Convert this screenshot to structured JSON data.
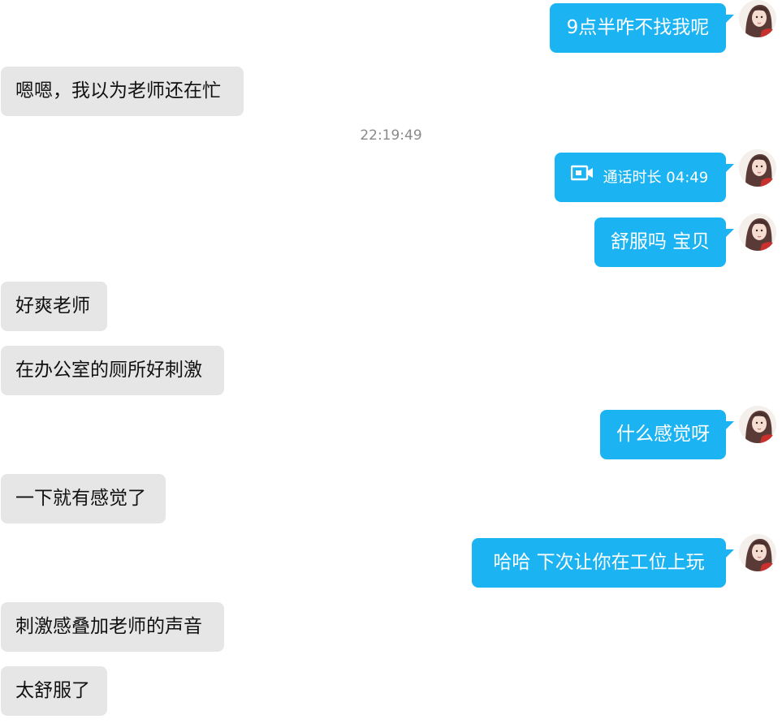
{
  "timestamp": "22:19:49",
  "messages": [
    {
      "side": "out",
      "text": "9点半咋不找我呢"
    },
    {
      "side": "in",
      "text": "嗯嗯，我以为老师还在忙"
    },
    {
      "side": "out",
      "type": "call",
      "icon": "video-camera-icon",
      "text": "通话时长 04:49"
    },
    {
      "side": "out",
      "text": "舒服吗 宝贝"
    },
    {
      "side": "in",
      "text": "好爽老师"
    },
    {
      "side": "in",
      "text": "在办公室的厕所好刺激"
    },
    {
      "side": "out",
      "text": "什么感觉呀"
    },
    {
      "side": "in",
      "text": "一下就有感觉了"
    },
    {
      "side": "out",
      "text": "哈哈  下次让你在工位上玩"
    },
    {
      "side": "in",
      "text": "刺激感叠加老师的声音"
    },
    {
      "side": "in",
      "text": "太舒服了"
    }
  ],
  "colors": {
    "outgoing_bubble": "#1bb3f2",
    "incoming_bubble": "#e6e6e6",
    "timestamp_text": "#8a8a8a"
  }
}
